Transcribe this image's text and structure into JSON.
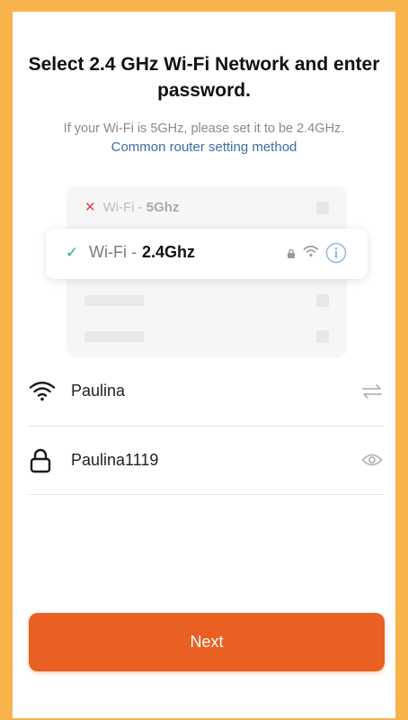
{
  "title": "Select 2.4 GHz Wi-Fi Network and enter password.",
  "hint": "If your Wi-Fi is 5GHz, please set it to be 2.4GHz.",
  "link": "Common router setting method",
  "illustration": {
    "row_5g_prefix": "Wi-Fi -",
    "row_5g_band": "5Ghz",
    "row_24_prefix": "Wi-Fi -",
    "row_24_band": "2.4Ghz"
  },
  "network": {
    "ssid": "Paulina",
    "password": "Paulina1119"
  },
  "next_label": "Next",
  "colors": {
    "frame": "#F6B44B",
    "accent": "#E96022",
    "link": "#3A6EA5",
    "check": "#2EAE7C",
    "cross": "#E3423F"
  }
}
